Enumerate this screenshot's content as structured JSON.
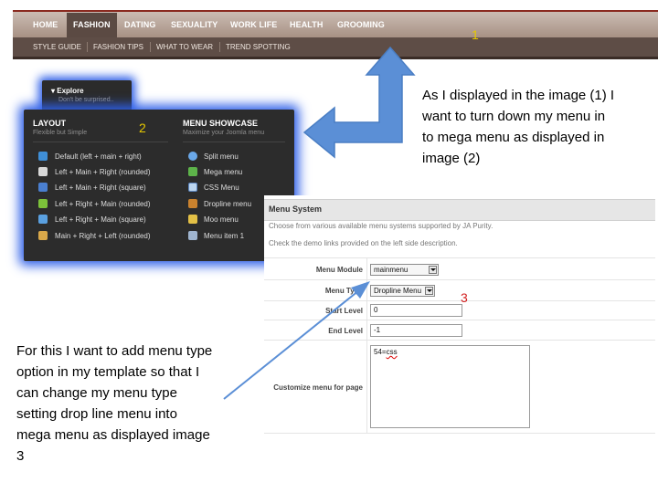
{
  "top_nav": {
    "items": [
      {
        "label": "HOME",
        "active": false
      },
      {
        "label": "FASHION",
        "active": true
      },
      {
        "label": "DATING",
        "active": false
      },
      {
        "label": "SEXUALITY",
        "active": false
      },
      {
        "label": "WORK LIFE",
        "active": false
      },
      {
        "label": "HEALTH",
        "active": false
      },
      {
        "label": "GROOMING",
        "active": false
      }
    ],
    "marker": "1"
  },
  "sub_nav": {
    "items": [
      "STYLE GUIDE",
      "FASHION TIPS",
      "WHAT TO WEAR",
      "TREND SPOTTING"
    ]
  },
  "mega_menu": {
    "explore_label": "▾ Explore",
    "explore_sub": "Don't be surprised..",
    "marker": "2",
    "layout_column": {
      "title": "LAYOUT",
      "subtitle": "Flexible but Simple",
      "items": [
        {
          "label": "Default (left + main + right)",
          "icon": "plus-icon"
        },
        {
          "label": "Left + Main + Right (rounded)",
          "icon": "grid-icon"
        },
        {
          "label": "Left + Main + Right (square)",
          "icon": "pencil-icon"
        },
        {
          "label": "Left + Right + Main (rounded)",
          "icon": "down-arrow-icon"
        },
        {
          "label": "Left + Right + Main (square)",
          "icon": "refresh-icon"
        },
        {
          "label": "Main + Right + Left (rounded)",
          "icon": "image-icon"
        }
      ]
    },
    "showcase_column": {
      "title": "MENU SHOWCASE",
      "subtitle": "Maximize your Joomla menu",
      "items": [
        {
          "label": "Split menu",
          "icon": "globe-icon"
        },
        {
          "label": "Mega menu",
          "icon": "chart-icon"
        },
        {
          "label": "CSS Menu",
          "icon": "css-icon"
        },
        {
          "label": "Dropline menu",
          "icon": "book-icon"
        },
        {
          "label": "Moo menu",
          "icon": "pencil-icon"
        },
        {
          "label": "Menu item 1",
          "icon": "printer-icon"
        }
      ]
    }
  },
  "menu_system": {
    "title": "Menu System",
    "desc1": "Choose from various available menu systems supported by JA Purity.",
    "desc2": "Check the demo links provided on the left side description.",
    "module_label": "Menu Module",
    "module_value": "mainmenu",
    "type_label": "Menu Type",
    "type_value": "Dropline Menu",
    "start_label": "Start Level",
    "start_value": "0",
    "end_label": "End Level",
    "end_value": "-1",
    "customize_label": "Customize menu for page",
    "customize_value_plain": "54=",
    "customize_value_spell": "css",
    "marker": "3"
  },
  "notes": {
    "right": [
      "As I displayed in the image (1) I",
      "want to turn down my menu in",
      "to mega menu as displayed in",
      "image (2)"
    ],
    "left": [
      "For this I want to add menu type",
      "option in my template so that I",
      "can change my menu type",
      "setting drop line menu into",
      "mega menu as displayed image",
      "3"
    ]
  },
  "colors": {
    "nav_bar": "#a79184",
    "nav_active": "#5b4a43",
    "mega_glow": "#2e5fe8",
    "arrow_fill": "#5b8fd6",
    "marker_yellow": "#e6c800",
    "marker_red": "#d32020"
  }
}
